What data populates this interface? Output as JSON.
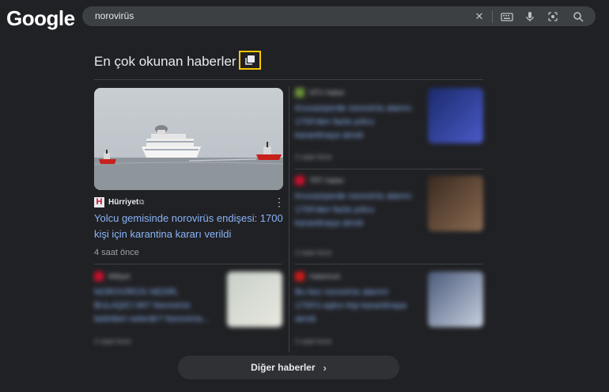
{
  "header": {
    "logo_text": "Google",
    "search_query": "norovirüs",
    "icons": [
      "close-icon",
      "keyboard-icon",
      "microphone-icon",
      "lens-icon",
      "search-icon"
    ]
  },
  "section": {
    "title": "En çok okunan haberler"
  },
  "main_story": {
    "source": "Hürriyet",
    "source_logo_letter": "H",
    "headline": "Yolcu gemisinde norovirüs endişesi: 1700 kişi için karantina kararı verildi",
    "time": "4 saat önce"
  },
  "blurred_stories": [
    {
      "source": "NTV Haber",
      "title": "Kruvaziyerde norovirüs alarmı: 1700'den fazla yolcu karantinaya alındı",
      "time": "2 saat önce",
      "icon_color": "#6b8f3a",
      "thumb": [
        "#1a2a6b",
        "#4a5ac8"
      ]
    },
    {
      "source": "TRT Haber",
      "title": "Kruvaziyerde norovirüs alarmı: 1700'den fazla yolcu karantinaya alındı",
      "time": "2 saat önce",
      "icon_color": "#c8102e",
      "thumb": [
        "#3a2a20",
        "#8a6a50"
      ]
    },
    {
      "source": "Milliyet",
      "title": "NOROVİRÜS NEDİR, BULAŞICI MI? Norovirüs belirtileri nelerdir? Norovirüs...",
      "time": "2 saat önce",
      "icon_color": "#c8102e",
      "thumb": [
        "#c8d0c8",
        "#e8e8e0"
      ]
    },
    {
      "source": "Haberturk",
      "title": "Bu kez norovirüs alarmı! 1700'ü aşkın kişi karantinaya alındı",
      "time": "2 saat önce",
      "icon_color": "#d01a1a",
      "thumb": [
        "#4a5a7a",
        "#c8d0e0"
      ]
    }
  ],
  "footer": {
    "more_label": "Diğer haberler"
  }
}
